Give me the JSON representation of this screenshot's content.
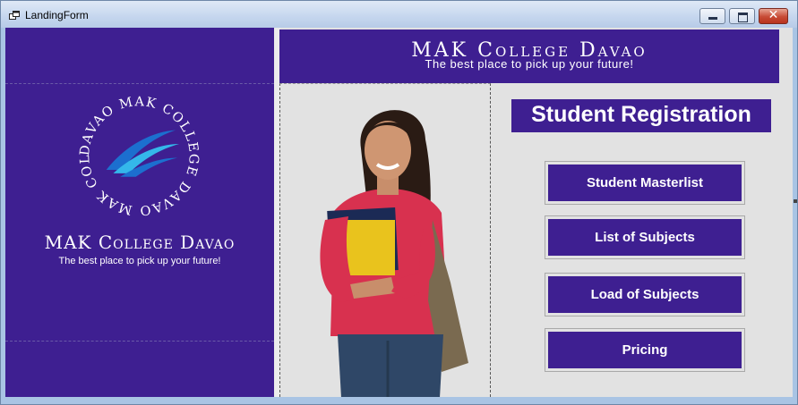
{
  "window": {
    "title": "LandingForm",
    "controls": {
      "minimize": "minimize-icon",
      "maximize": "maximize-icon",
      "close": "✕"
    }
  },
  "brand": {
    "name": "MAK College Davao",
    "tagline": "The best place to pick up your future!",
    "logo_ring_text": "DAVAO MAK COLLEGE DAVAO MAK COLLEGE ",
    "colors": {
      "primary": "#3e1f91",
      "logo_wave_light": "#34b7ea",
      "logo_wave_dark": "#1c6fcf"
    }
  },
  "header": {
    "name": "MAK College Davao",
    "tagline": "The best place to pick up your future!"
  },
  "registration": {
    "title": "Student Registration",
    "buttons": [
      {
        "label": "Student Masterlist"
      },
      {
        "label": "List of Subjects"
      },
      {
        "label": "Load of Subjects"
      },
      {
        "label": "Pricing"
      }
    ]
  }
}
